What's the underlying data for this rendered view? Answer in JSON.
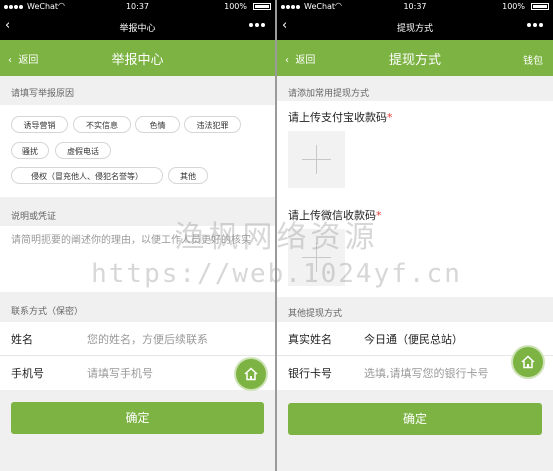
{
  "status_bar": {
    "carrier": "WeChat",
    "time": "10:37",
    "battery": "100%",
    "signal_bars": 5,
    "battery_level": 1.0
  },
  "colors": {
    "brand_green": "#7cb342",
    "required_red": "#e53935",
    "background": "#f0f0f0"
  },
  "left": {
    "wx_title": "举报中心",
    "nav": {
      "back": "返回",
      "title": "举报中心"
    },
    "reason_label": "请填写举报原因",
    "tags": [
      "诱导营销",
      "不实信息",
      "色情",
      "违法犯罪",
      "骚扰",
      "虚假电话",
      "侵权（冒充他人、侵犯名誉等）",
      "其他"
    ],
    "evidence_label": "说明或凭证",
    "evidence_placeholder": "请简明扼要的阐述你的理由，以便工作人员更好的核实",
    "contact_label": "联系方式（保密）",
    "name": {
      "label": "姓名",
      "placeholder": "您的姓名，方便后续联系"
    },
    "phone": {
      "label": "手机号",
      "placeholder": "请填写手机号"
    },
    "submit": "确定"
  },
  "right": {
    "wx_title": "提现方式",
    "nav": {
      "back": "返回",
      "title": "提现方式",
      "right": "钱包"
    },
    "add_label": "请添加常用提现方式",
    "alipay_upload": {
      "title": "请上传支付宝收款码",
      "required": "*"
    },
    "wechat_upload": {
      "title": "请上传微信收款码",
      "required": "*"
    },
    "other_label": "其他提现方式",
    "real_name": {
      "label": "真实姓名",
      "value": "今日通（便民总站）"
    },
    "bank_card": {
      "label": "银行卡号",
      "placeholder": "选填,请填写您的银行卡号"
    },
    "submit": "确定"
  },
  "watermark": {
    "line1": "渔枫网络资源",
    "line2": "https://web.1024yf.cn"
  }
}
